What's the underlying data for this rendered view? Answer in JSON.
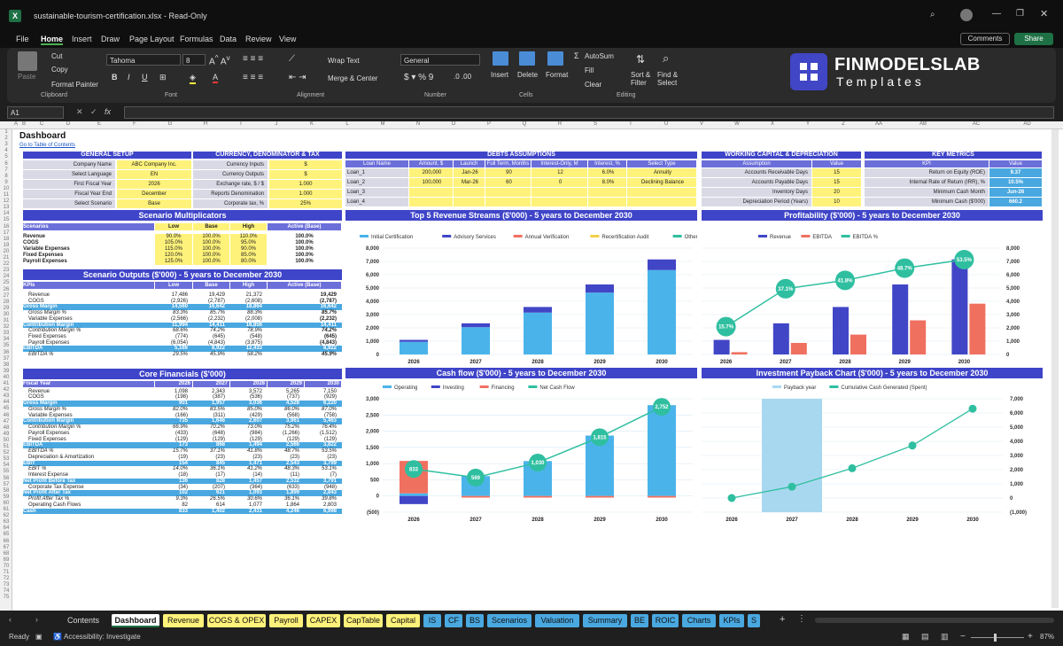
{
  "window": {
    "title": "sustainable-tourism-certification.xlsx  -  Read-Only"
  },
  "menu": [
    "File",
    "Home",
    "Insert",
    "Draw",
    "Page Layout",
    "Formulas",
    "Data",
    "Review",
    "View"
  ],
  "menu_right": {
    "comments": "Comments",
    "share": "Share"
  },
  "ribbon": {
    "paste": "Paste",
    "cut": "Cut",
    "copy": "Copy",
    "format_painter": "Format Painter",
    "clipboard": "Clipboard",
    "font_name": "Tahoma",
    "font_size": "8",
    "font": "Font",
    "wrap": "Wrap Text",
    "merge": "Merge & Center",
    "alignment": "Alignment",
    "number_format": "General",
    "number": "Number",
    "insert": "Insert",
    "delete": "Delete",
    "format": "Format",
    "cells": "Cells",
    "autosum": "AutoSum",
    "fill": "Fill",
    "clear": "Clear",
    "sort": "Sort & Filter",
    "find": "Find & Select",
    "editing": "Editing"
  },
  "logo": {
    "line1": "FINMODELSLAB",
    "line2": "Templates"
  },
  "formula_bar": {
    "cell": "A1",
    "fx": "fx"
  },
  "columns": [
    "A",
    "B",
    "C",
    "D",
    "E",
    "F",
    "G",
    "H",
    "I",
    "J",
    "K",
    "L",
    "M",
    "N",
    "O",
    "P",
    "Q",
    "R",
    "S",
    "T",
    "U",
    "V",
    "W",
    "X",
    "Y",
    "Z",
    "AA",
    "AB",
    "AC",
    "AD"
  ],
  "sheet": {
    "title": "Dashboard",
    "toc_link": "Go to Table of Contents",
    "general_setup": {
      "header": "GENERAL SETUP",
      "rows": [
        [
          "Company Name",
          "ABC Company Inc."
        ],
        [
          "Select Language",
          "EN"
        ],
        [
          "First Fiscal Year",
          "2026"
        ],
        [
          "Fiscal Year End",
          "December"
        ],
        [
          "Select Scenario",
          "Base"
        ]
      ]
    },
    "currency": {
      "header": "CURRENCY, DENOMINATOR & TAX",
      "rows": [
        [
          "Currency Inputs",
          "$"
        ],
        [
          "Currency Outputs",
          "$"
        ],
        [
          "Exchange rate, $ / $",
          "1.000"
        ],
        [
          "Reports Denomination",
          "1.000"
        ],
        [
          "Corporate tax, %",
          "25%"
        ]
      ]
    },
    "debts": {
      "header": "DEBTS ASSUMPTIONS",
      "cols": [
        "Loan Name",
        "Amount, $",
        "Launch",
        "Full Term, Months",
        "Interest-Only, M",
        "Interest, %",
        "Select Type"
      ],
      "rows": [
        [
          "Loan_1",
          "200,000",
          "Jan-26",
          "90",
          "12",
          "6.0%",
          "Annuity"
        ],
        [
          "Loan_2",
          "100,000",
          "Mar-26",
          "60",
          "0",
          "8.0%",
          "Declining Balance"
        ],
        [
          "Loan_3",
          "",
          "",
          "",
          "",
          "",
          ""
        ],
        [
          "Loan_4",
          "",
          "",
          "",
          "",
          "",
          ""
        ]
      ]
    },
    "working_capital": {
      "header": "WORKING CAPITAL & DEPRECIATION",
      "cols": [
        "Assumption",
        "Value"
      ],
      "rows": [
        [
          "Accounts Receivable Days",
          "15"
        ],
        [
          "Accounts Payable Days",
          "15"
        ],
        [
          "Inventory Days",
          "20"
        ],
        [
          "Depreciation Period (Years)",
          "10"
        ]
      ]
    },
    "kpis": {
      "header": "KEY METRICS",
      "cols": [
        "KPI",
        "Value"
      ],
      "rows": [
        [
          "Return on Equity (ROE)",
          "9.37"
        ],
        [
          "Internal Rate of Return (IRR), %",
          "10.5%"
        ],
        [
          "Minimum Cash Month",
          "Jun-26"
        ],
        [
          "Minimum Cash ($'000)",
          "660.2"
        ]
      ]
    },
    "scenario_mult": {
      "header": "Scenario Multiplicators",
      "cols": [
        "Scenarios",
        "Low",
        "Base",
        "High",
        "Active (Base)"
      ],
      "rows": [
        [
          "Revenue",
          "90.0%",
          "100.0%",
          "110.0%",
          "100.0%"
        ],
        [
          "COGS",
          "105.0%",
          "100.0%",
          "95.0%",
          "100.0%"
        ],
        [
          "Variable Expenses",
          "115.0%",
          "100.0%",
          "90.0%",
          "100.0%"
        ],
        [
          "Fixed Expenses",
          "120.0%",
          "100.0%",
          "85.0%",
          "100.0%"
        ],
        [
          "Payroll Expenses",
          "125.0%",
          "100.0%",
          "80.0%",
          "100.0%"
        ]
      ]
    },
    "scenario_out": {
      "header": "Scenario Outputs ($'000) - 5 years to December 2030",
      "cols": [
        "KPIs",
        "Low",
        "Base",
        "High",
        "Active (Base)"
      ],
      "rows": [
        [
          "Revenue",
          "17,486",
          "19,429",
          "21,372",
          "19,429"
        ],
        [
          "COGS",
          "(2,926)",
          "(2,787)",
          "(2,608)",
          "(2,787)"
        ],
        [
          "Gross Margin",
          "14,560",
          "16,642",
          "18,864",
          "16,642"
        ],
        [
          "Gross Margin %",
          "83.3%",
          "85.7%",
          "88.3%",
          "85.7%"
        ],
        [
          "Variable Expenses",
          "(2,566)",
          "(2,232)",
          "(2,008)",
          "(2,232)"
        ],
        [
          "Contribution Margin",
          "11,994",
          "14,411",
          "16,856",
          "14,411"
        ],
        [
          "Contribution Margin %",
          "68.6%",
          "74.2%",
          "78.9%",
          "74.2%"
        ],
        [
          "Fixed Expenses",
          "(774)",
          "(645)",
          "(548)",
          "(645)"
        ],
        [
          "Payroll Expenses",
          "(6,054)",
          "(4,843)",
          "(3,875)",
          "(4,843)"
        ],
        [
          "EBITDA",
          "5,166",
          "8,922",
          "12,433",
          "8,922"
        ],
        [
          "EBITDA %",
          "29.5%",
          "45.9%",
          "58.2%",
          "45.9%"
        ]
      ]
    },
    "core": {
      "header": "Core Financials ($'000)",
      "cols": [
        "Fiscal Year",
        "2026",
        "2027",
        "2028",
        "2029",
        "2030"
      ],
      "rows": [
        [
          "Revenue",
          "1,098",
          "2,343",
          "3,572",
          "5,265",
          "7,150"
        ],
        [
          "COGS",
          "(198)",
          "(387)",
          "(536)",
          "(737)",
          "(929)"
        ],
        [
          "Gross Margin",
          "901",
          "1,957",
          "3,036",
          "4,528",
          "6,220"
        ],
        [
          "Gross Margin %",
          "82.0%",
          "83.5%",
          "85.0%",
          "86.0%",
          "87.0%"
        ],
        [
          "Variable Expenses",
          "(166)",
          "(311)",
          "(429)",
          "(568)",
          "(758)"
        ],
        [
          "Contribution Margin",
          "735",
          "1,646",
          "2,607",
          "3,961",
          "5,463"
        ],
        [
          "Contribution Margin %",
          "66.9%",
          "70.2%",
          "73.0%",
          "75.2%",
          "76.4%"
        ],
        [
          "Payroll Expenses",
          "(433)",
          "(648)",
          "(984)",
          "(1,266)",
          "(1,512)"
        ],
        [
          "Fixed Expenses",
          "(129)",
          "(129)",
          "(129)",
          "(129)",
          "(129)"
        ],
        [
          "EBITDA",
          "173",
          "868",
          "1,494",
          "2,566",
          "3,822"
        ],
        [
          "EBITDA %",
          "15.7%",
          "37.1%",
          "41.8%",
          "48.7%",
          "53.5%"
        ],
        [
          "Depreciation & Amortization",
          "(19)",
          "(23)",
          "(23)",
          "(23)",
          "(23)"
        ],
        [
          "EBIT",
          "154",
          "845",
          "1,471",
          "2,543",
          "3,799"
        ],
        [
          "EBIT %",
          "14.0%",
          "36.1%",
          "41.2%",
          "48.3%",
          "53.1%"
        ],
        [
          "Interest Expense",
          "(18)",
          "(17)",
          "(14)",
          "(11)",
          "(7)"
        ],
        [
          "Net Profit Before Tax",
          "136",
          "828",
          "1,457",
          "2,532",
          "3,791"
        ],
        [
          "Corporate Tax Expense",
          "(34)",
          "(207)",
          "(364)",
          "(633)",
          "(948)"
        ],
        [
          "Net Profit After Tax",
          "102",
          "621",
          "1,093",
          "1,899",
          "2,843"
        ],
        [
          "Profit After Tax %",
          "9.3%",
          "26.5%",
          "30.6%",
          "36.1%",
          "39.8%"
        ],
        [
          "Operating Cash Flows",
          "82",
          "614",
          "1,077",
          "1,864",
          "2,803"
        ],
        [
          "Cash",
          "833",
          "1,402",
          "2,431",
          "4,246",
          "6,998"
        ]
      ]
    }
  },
  "chart_data": [
    {
      "type": "bar",
      "title": "Top 5 Revenue Streams ($'000) - 5 years to December 2030",
      "categories": [
        "2026",
        "2027",
        "2028",
        "2029",
        "2030"
      ],
      "ylim": [
        0,
        8000
      ],
      "stacked": true,
      "series": [
        {
          "name": "Initial Certification",
          "color": "#4ab4ea",
          "values": [
            950,
            2050,
            3150,
            4650,
            6350
          ]
        },
        {
          "name": "Advisory Services",
          "color": "#4146c6",
          "values": [
            148,
            293,
            422,
            615,
            800
          ]
        },
        {
          "name": "Annual Verification",
          "color": "#f07060",
          "values": [
            0,
            0,
            0,
            0,
            0
          ]
        },
        {
          "name": "Recertification Audit",
          "color": "#f2d24a",
          "values": [
            0,
            0,
            0,
            0,
            0
          ]
        },
        {
          "name": "Other Revenue",
          "color": "#2fbfa0",
          "values": [
            0,
            0,
            0,
            0,
            0
          ]
        }
      ]
    },
    {
      "type": "bar",
      "title": "Profitability ($'000) - 5 years to December 2030",
      "categories": [
        "2026",
        "2027",
        "2028",
        "2029",
        "2030"
      ],
      "ylim": [
        0,
        8000
      ],
      "series": [
        {
          "name": "Revenue",
          "color": "#4146c6",
          "values": [
            1098,
            2343,
            3572,
            5265,
            7150
          ]
        },
        {
          "name": "EBITDA",
          "color": "#f07060",
          "values": [
            173,
            868,
            1494,
            2566,
            3822
          ]
        },
        {
          "name": "EBITDA %",
          "color": "#2fbfa0",
          "labels": [
            "15.7%",
            "37.1%",
            "41.8%",
            "48.7%",
            "53.5%"
          ],
          "values": [
            15.7,
            37.1,
            41.8,
            48.7,
            53.5
          ]
        }
      ]
    },
    {
      "type": "bar",
      "title": "Cash flow ($'000) - 5 years to December 2030",
      "categories": [
        "2026",
        "2027",
        "2028",
        "2029",
        "2030"
      ],
      "ylim": [
        -500,
        3000
      ],
      "series": [
        {
          "name": "Operating",
          "color": "#4ab4ea",
          "values": [
            82,
            614,
            1077,
            1864,
            2803
          ]
        },
        {
          "name": "Investing",
          "color": "#4146c6",
          "values": [
            -250,
            0,
            0,
            0,
            0
          ]
        },
        {
          "name": "Financing",
          "color": "#f07060",
          "values": [
            1000,
            -50,
            -50,
            -50,
            -50
          ]
        },
        {
          "name": "Net Cash Flow",
          "color": "#2fbfa0",
          "labels": [
            "833",
            "569",
            "1,030",
            "1,815",
            "2,752"
          ],
          "values": [
            833,
            569,
            1030,
            1815,
            2752
          ]
        }
      ]
    },
    {
      "type": "line",
      "title": "Investment Payback Chart ($'000) - 5 years to December 2030",
      "categories": [
        "2026",
        "2027",
        "2028",
        "2029",
        "2030"
      ],
      "ylim": [
        -1000,
        7000
      ],
      "series": [
        {
          "name": "Payback year",
          "color": "#a8d8f0",
          "values": [
            0,
            1,
            0,
            0,
            0
          ]
        },
        {
          "name": "Cumulative Cash Generated (Spent)",
          "color": "#2fbfa0",
          "values": [
            0,
            800,
            2100,
            3700,
            6300
          ]
        }
      ]
    }
  ],
  "tabs": [
    "Contents",
    "Dashboard",
    "Revenue",
    "COGS & OPEX",
    "Payroll",
    "CAPEX",
    "CapTable",
    "Capital",
    "IS",
    "CF",
    "BS",
    "Scenarios",
    "Valuation",
    "Summary",
    "BE",
    "ROIC",
    "Charts",
    "KPIs",
    "S"
  ],
  "status": {
    "ready": "Ready",
    "accessibility": "Accessibility: Investigate",
    "zoom": "87%"
  }
}
